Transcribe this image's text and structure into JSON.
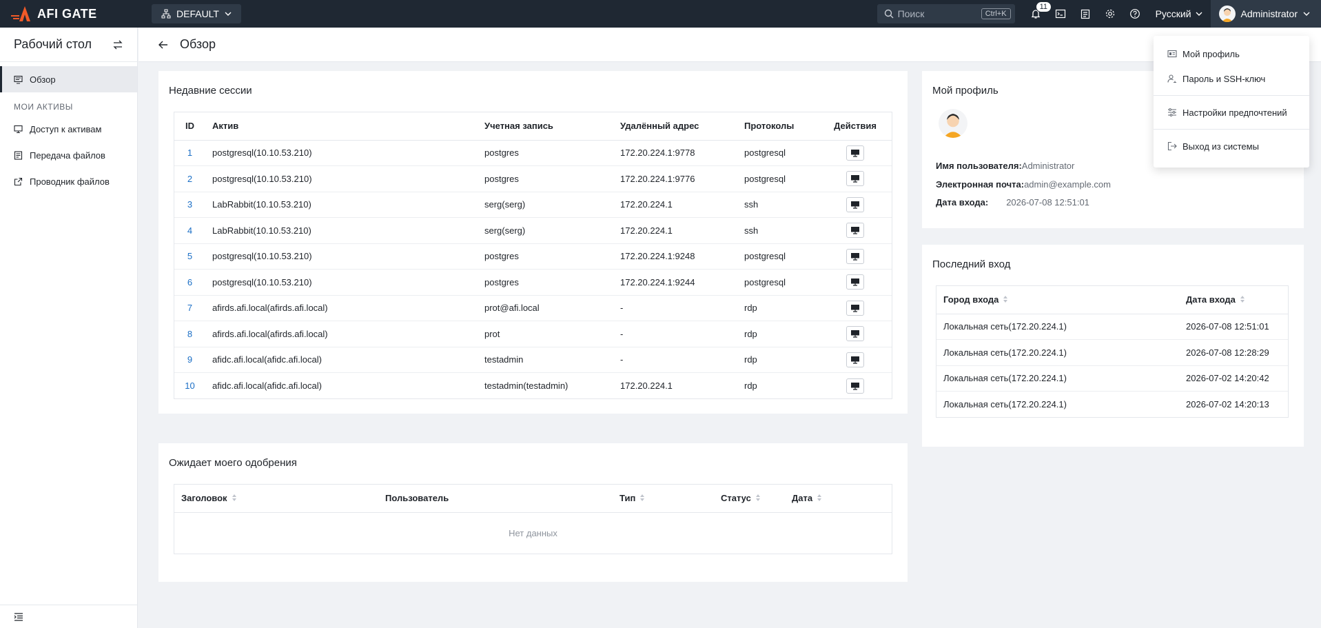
{
  "app": {
    "brand": "AFI GATE",
    "org": "DEFAULT"
  },
  "topbar": {
    "search_placeholder": "Поиск",
    "search_shortcut": "Ctrl+K",
    "notification_count": "11",
    "language": "Русский",
    "user": "Administrator"
  },
  "sidebar": {
    "title": "Рабочий стол",
    "overview": "Обзор",
    "section": "МОИ АКТИВЫ",
    "items": [
      "Доступ к активам",
      "Передача файлов",
      "Проводник файлов"
    ]
  },
  "page": {
    "title": "Обзор"
  },
  "sessions": {
    "title": "Недавние сессии",
    "headers": [
      "ID",
      "Актив",
      "Учетная запись",
      "Удалённый адрес",
      "Протоколы",
      "Действия"
    ],
    "rows": [
      [
        "1",
        "postgresql(10.10.53.210)",
        "postgres",
        "172.20.224.1:9778",
        "postgresql"
      ],
      [
        "2",
        "postgresql(10.10.53.210)",
        "postgres",
        "172.20.224.1:9776",
        "postgresql"
      ],
      [
        "3",
        "LabRabbit(10.10.53.210)",
        "serg(serg)",
        "172.20.224.1",
        "ssh"
      ],
      [
        "4",
        "LabRabbit(10.10.53.210)",
        "serg(serg)",
        "172.20.224.1",
        "ssh"
      ],
      [
        "5",
        "postgresql(10.10.53.210)",
        "postgres",
        "172.20.224.1:9248",
        "postgresql"
      ],
      [
        "6",
        "postgresql(10.10.53.210)",
        "postgres",
        "172.20.224.1:9244",
        "postgresql"
      ],
      [
        "7",
        "afirds.afi.local(afirds.afi.local)",
        "prot@afi.local",
        " -",
        "rdp"
      ],
      [
        "8",
        "afirds.afi.local(afirds.afi.local)",
        "prot",
        " -",
        "rdp"
      ],
      [
        "9",
        "afidc.afi.local(afidc.afi.local)",
        "testadmin",
        " -",
        "rdp"
      ],
      [
        "10",
        "afidc.afi.local(afidc.afi.local)",
        "testadmin(testadmin)",
        "172.20.224.1",
        "rdp"
      ]
    ]
  },
  "approval": {
    "title": "Ожидает моего одобрения",
    "headers": [
      "Заголовок",
      "Пользователь",
      "Тип",
      "Статус",
      "Дата"
    ],
    "empty": "Нет данных"
  },
  "profile": {
    "title": "Мой профиль",
    "username_label": "Имя пользователя:",
    "username": "Administrator",
    "email_label": "Электронная почта:",
    "email": "admin@example.com",
    "login_label": "Дата входа:",
    "login_date": "2026-07-08 12:51:01"
  },
  "last_login": {
    "title": "Последний вход",
    "headers": [
      "Город входа",
      "Дата входа"
    ],
    "rows": [
      [
        "Локальная сеть(172.20.224.1)",
        "2026-07-08 12:51:01"
      ],
      [
        "Локальная сеть(172.20.224.1)",
        "2026-07-08 12:28:29"
      ],
      [
        "Локальная сеть(172.20.224.1)",
        "2026-07-02 14:20:42"
      ],
      [
        "Локальная сеть(172.20.224.1)",
        "2026-07-02 14:20:13"
      ]
    ]
  },
  "user_menu": {
    "my_profile": "Мой профиль",
    "password_ssh": "Пароль и SSH-ключ",
    "preferences": "Настройки предпочтений",
    "logout": "Выход из системы"
  },
  "colors": {
    "topbar": "#1f2833",
    "link": "#1b6fc6",
    "brand_accent": "#f05a28"
  }
}
